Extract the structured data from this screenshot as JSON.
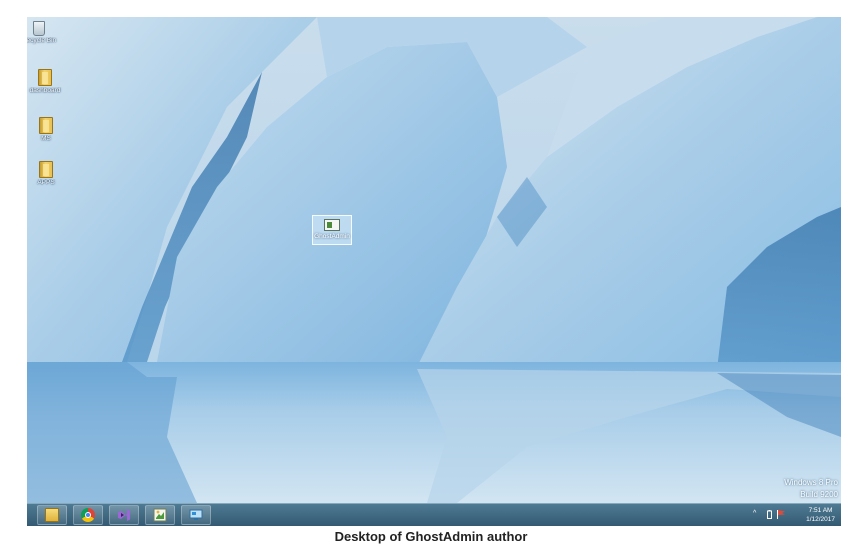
{
  "desktop": {
    "icons": [
      {
        "label": "Recycle Bin",
        "icon": "recycle-bin-icon"
      },
      {
        "label": "dashboard",
        "icon": "folder-icon"
      },
      {
        "label": "MS",
        "icon": "folder-icon"
      },
      {
        "label": "APPS",
        "icon": "folder-icon"
      }
    ],
    "selected_icon": {
      "label": "GhostAdmin",
      "icon": "ghostadmin-app-icon"
    }
  },
  "watermark": {
    "line1": "Windows 8 Pro",
    "line2": "Build 9200"
  },
  "taskbar": {
    "pinned": [
      {
        "name": "file-explorer",
        "icon": "folder-icon"
      },
      {
        "name": "google-chrome",
        "icon": "chrome-icon"
      },
      {
        "name": "visual-studio",
        "icon": "visual-studio-icon"
      },
      {
        "name": "paint",
        "icon": "paint-icon"
      },
      {
        "name": "remote-desktop",
        "icon": "remote-desktop-icon"
      }
    ],
    "tray": {
      "chevron": "^",
      "time": "7:51 AM",
      "date": "1/12/2017"
    }
  },
  "caption": "Desktop of GhostAdmin author",
  "colors": {
    "taskbar": "#3d6680",
    "ice_light": "#bcd6ea",
    "ice_deep": "#2f6ea6"
  }
}
